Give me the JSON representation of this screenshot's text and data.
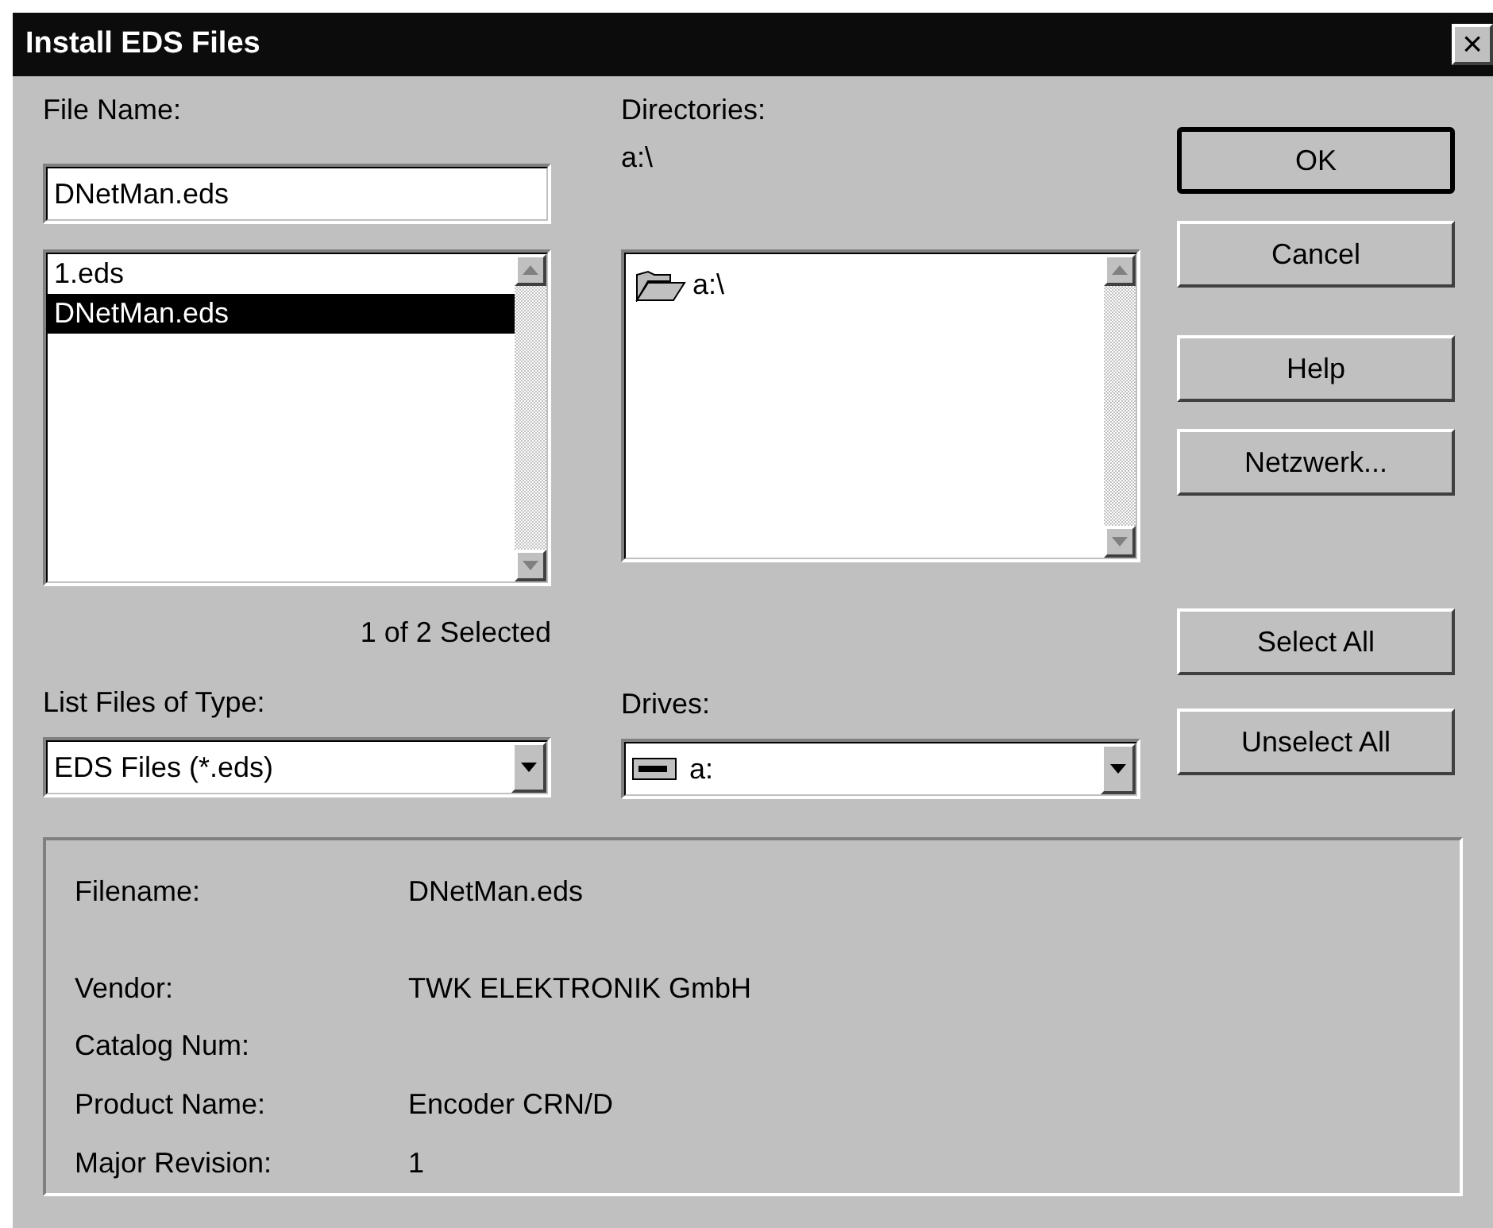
{
  "window": {
    "title": "Install EDS Files",
    "close": "×"
  },
  "file_name": {
    "label": "File Name:",
    "value": "DNetMan.eds"
  },
  "files": [
    {
      "name": "1.eds",
      "selected": false
    },
    {
      "name": "DNetMan.eds",
      "selected": true
    }
  ],
  "selection_count": "1 of 2 Selected",
  "file_type": {
    "label": "List Files of Type:",
    "value": "EDS Files (*.eds)"
  },
  "directories": {
    "label": "Directories:",
    "path": "a:\\",
    "items": [
      {
        "name": "a:\\",
        "selected": false
      }
    ]
  },
  "drives": {
    "label": "Drives:",
    "value": "a:"
  },
  "buttons": [
    {
      "label": "OK",
      "default": true
    },
    {
      "label": "Cancel",
      "default": false
    },
    {
      "label": "Help",
      "default": false
    },
    {
      "label": "Netzwerk...",
      "default": false
    }
  ],
  "select_buttons": [
    {
      "label": "Select All"
    },
    {
      "label": "Unselect All"
    }
  ],
  "info": [
    {
      "label": "Filename:",
      "value": "DNetMan.eds"
    },
    {
      "label": "Vendor:",
      "value": "TWK ELEKTRONIK GmbH"
    },
    {
      "label": "Catalog Num:"
    },
    {
      "label": "Product Name:",
      "value": "Encoder CRN/D"
    },
    {
      "label": "Major Revision:",
      "value": "1"
    }
  ]
}
